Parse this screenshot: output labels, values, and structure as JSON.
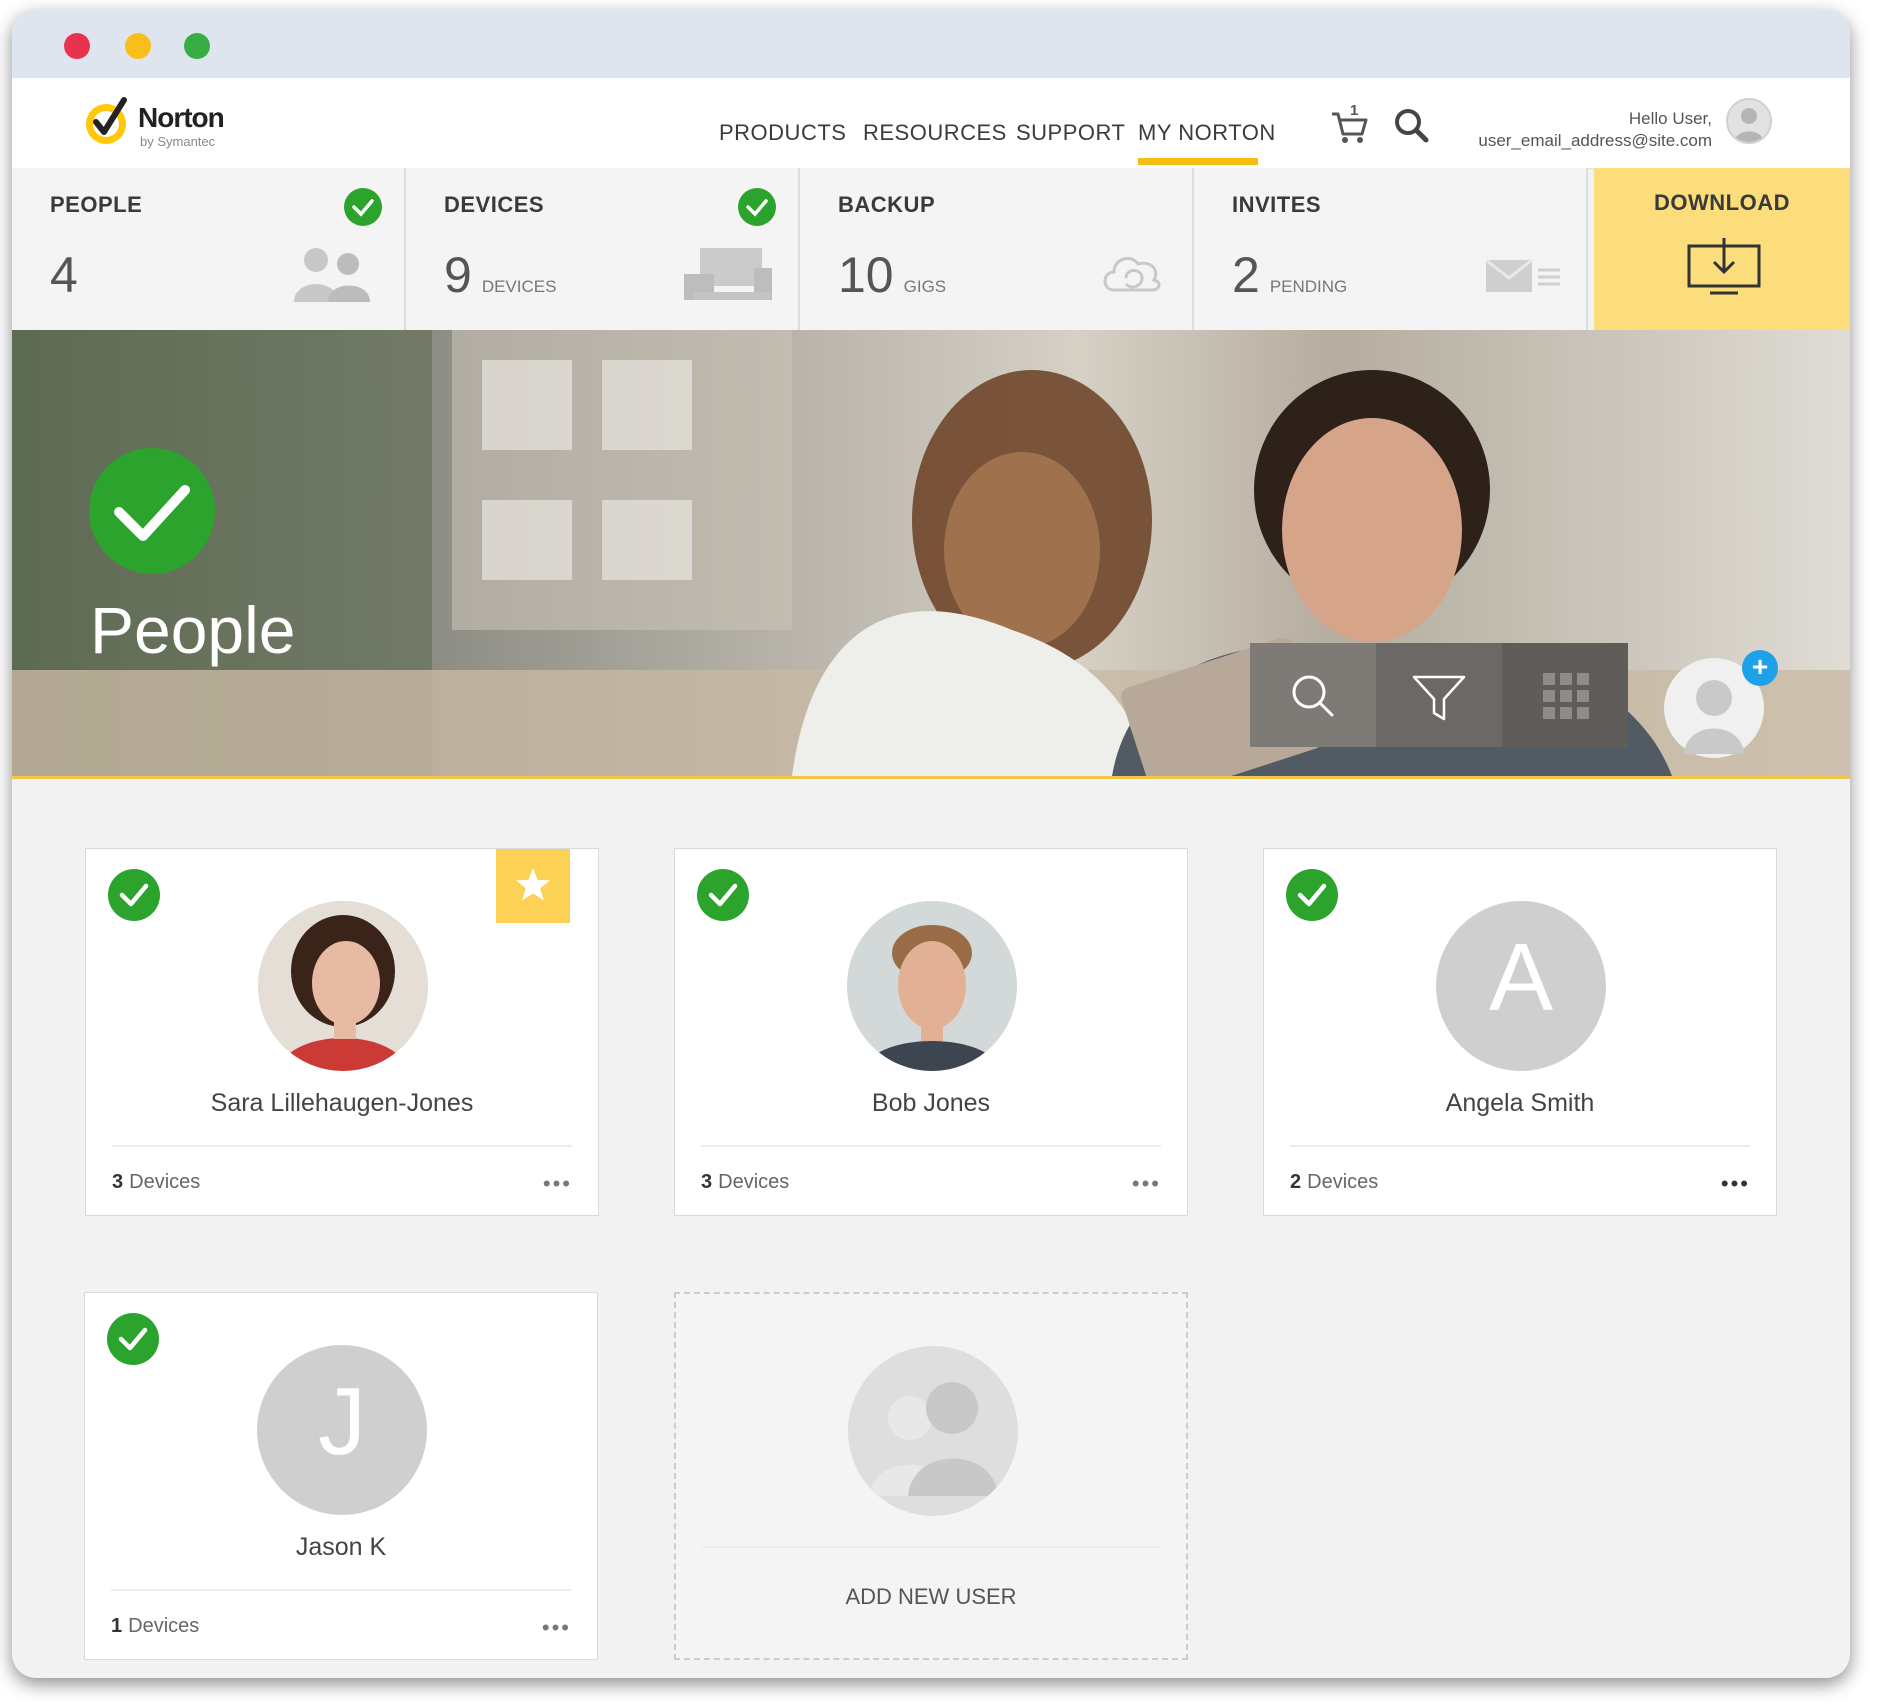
{
  "nav": {
    "logo_name": "Norton",
    "logo_sub": "by Symantec",
    "items": [
      {
        "label": "PRODUCTS"
      },
      {
        "label": "RESOURCES"
      },
      {
        "label": "SUPPORT"
      },
      {
        "label": "MY NORTON"
      }
    ],
    "cart_count": "1",
    "greeting": "Hello User,",
    "email": "user_email_address@site.com"
  },
  "stats": {
    "people": {
      "label": "PEOPLE",
      "value": "4"
    },
    "devices": {
      "label": "DEVICES",
      "value": "9",
      "unit": "DEVICES"
    },
    "backup": {
      "label": "BACKUP",
      "value": "10",
      "unit": "GIGS"
    },
    "invites": {
      "label": "INVITES",
      "value": "2",
      "unit": "PENDING"
    },
    "download": {
      "label": "DOWNLOAD"
    }
  },
  "hero": {
    "title": "People"
  },
  "cards": [
    {
      "name": "Sara Lillehaugen-Jones",
      "devices_count": "3",
      "devices_label": "Devices",
      "starred": true
    },
    {
      "name": "Bob Jones",
      "devices_count": "3",
      "devices_label": "Devices"
    },
    {
      "name": "Angela Smith",
      "devices_count": "2",
      "devices_label": "Devices",
      "initial": "A"
    },
    {
      "name": "Jason K",
      "devices_count": "1",
      "devices_label": "Devices",
      "initial": "J"
    }
  ],
  "add_user": {
    "label": "ADD NEW USER"
  },
  "menu_glyph": "•••",
  "colors": {
    "accent": "#f7bd14",
    "check_green": "#2ca32c",
    "download_bg": "#fbdd7c",
    "plus_blue": "#1ea1e8"
  }
}
